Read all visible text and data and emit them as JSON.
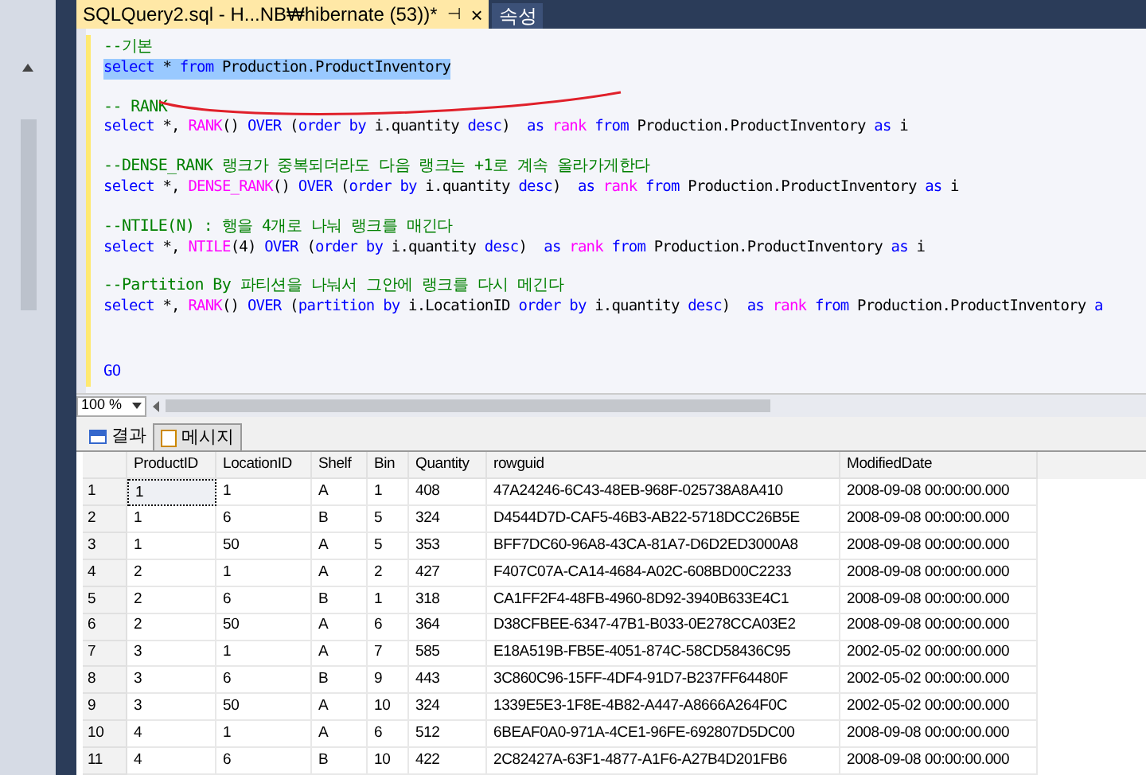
{
  "tabs": [
    {
      "label": "SQLQuery2.sql - H...NB₩hibernate (53))*",
      "selected": true,
      "pin": "⊣",
      "close": "×"
    },
    {
      "label": "속성",
      "selected": false
    }
  ],
  "editor": {
    "blocks": [
      [
        {
          "selected": false,
          "segments": [
            {
              "kind": "comment",
              "text": "--기본"
            }
          ]
        },
        {
          "selected": true,
          "segments": [
            {
              "kind": "keyword",
              "text": "select"
            },
            {
              "kind": "plain",
              "text": " * "
            },
            {
              "kind": "keyword",
              "text": "from"
            },
            {
              "kind": "plain",
              "text": " Production.ProductInventory"
            }
          ]
        }
      ],
      [
        {
          "selected": false,
          "segments": [
            {
              "kind": "comment",
              "text": "-- RANK"
            }
          ]
        },
        {
          "selected": false,
          "segments": [
            {
              "kind": "keyword",
              "text": "select"
            },
            {
              "kind": "plain",
              "text": " *, "
            },
            {
              "kind": "function",
              "text": "RANK"
            },
            {
              "kind": "plain",
              "text": "() "
            },
            {
              "kind": "keyword",
              "text": "OVER"
            },
            {
              "kind": "plain",
              "text": " ("
            },
            {
              "kind": "keyword",
              "text": "order by"
            },
            {
              "kind": "plain",
              "text": " i.quantity "
            },
            {
              "kind": "keyword",
              "text": "desc"
            },
            {
              "kind": "plain",
              "text": ")  "
            },
            {
              "kind": "keyword",
              "text": "as "
            },
            {
              "kind": "function",
              "text": "rank "
            },
            {
              "kind": "keyword",
              "text": "from"
            },
            {
              "kind": "plain",
              "text": " Production.ProductInventory "
            },
            {
              "kind": "keyword",
              "text": "as"
            },
            {
              "kind": "plain",
              "text": " i"
            }
          ]
        }
      ],
      [
        {
          "selected": false,
          "segments": [
            {
              "kind": "comment",
              "text": "--DENSE_RANK 랭크가 중복되더라도 다음 랭크는 +1로 계속 올라가게한다"
            }
          ]
        },
        {
          "selected": false,
          "segments": [
            {
              "kind": "keyword",
              "text": "select"
            },
            {
              "kind": "plain",
              "text": " *, "
            },
            {
              "kind": "function",
              "text": "DENSE_RANK"
            },
            {
              "kind": "plain",
              "text": "() "
            },
            {
              "kind": "keyword",
              "text": "OVER"
            },
            {
              "kind": "plain",
              "text": " ("
            },
            {
              "kind": "keyword",
              "text": "order by"
            },
            {
              "kind": "plain",
              "text": " i.quantity "
            },
            {
              "kind": "keyword",
              "text": "desc"
            },
            {
              "kind": "plain",
              "text": ")  "
            },
            {
              "kind": "keyword",
              "text": "as "
            },
            {
              "kind": "function",
              "text": "rank "
            },
            {
              "kind": "keyword",
              "text": "from"
            },
            {
              "kind": "plain",
              "text": " Production.ProductInventory "
            },
            {
              "kind": "keyword",
              "text": "as"
            },
            {
              "kind": "plain",
              "text": " i"
            }
          ]
        }
      ],
      [
        {
          "selected": false,
          "segments": [
            {
              "kind": "comment",
              "text": "--NTILE(N) : 행을 4개로 나눠 랭크를 매긴다"
            }
          ]
        },
        {
          "selected": false,
          "segments": [
            {
              "kind": "keyword",
              "text": "select"
            },
            {
              "kind": "plain",
              "text": " *, "
            },
            {
              "kind": "function",
              "text": "NTILE"
            },
            {
              "kind": "plain",
              "text": "(4) "
            },
            {
              "kind": "keyword",
              "text": "OVER"
            },
            {
              "kind": "plain",
              "text": " ("
            },
            {
              "kind": "keyword",
              "text": "order by"
            },
            {
              "kind": "plain",
              "text": " i.quantity "
            },
            {
              "kind": "keyword",
              "text": "desc"
            },
            {
              "kind": "plain",
              "text": ")  "
            },
            {
              "kind": "keyword",
              "text": "as "
            },
            {
              "kind": "function",
              "text": "rank "
            },
            {
              "kind": "keyword",
              "text": "from"
            },
            {
              "kind": "plain",
              "text": " Production.ProductInventory "
            },
            {
              "kind": "keyword",
              "text": "as"
            },
            {
              "kind": "plain",
              "text": " i"
            }
          ]
        }
      ],
      [
        {
          "selected": false,
          "segments": [
            {
              "kind": "comment",
              "text": "--Partition By 파티션을 나눠서 그안에 랭크를 다시 메긴다"
            }
          ]
        },
        {
          "selected": false,
          "segments": [
            {
              "kind": "keyword",
              "text": "select"
            },
            {
              "kind": "plain",
              "text": " *, "
            },
            {
              "kind": "function",
              "text": "RANK"
            },
            {
              "kind": "plain",
              "text": "() "
            },
            {
              "kind": "keyword",
              "text": "OVER"
            },
            {
              "kind": "plain",
              "text": " ("
            },
            {
              "kind": "keyword",
              "text": "partition by"
            },
            {
              "kind": "plain",
              "text": " i.LocationID "
            },
            {
              "kind": "keyword",
              "text": "order by"
            },
            {
              "kind": "plain",
              "text": " i.quantity "
            },
            {
              "kind": "keyword",
              "text": "desc"
            },
            {
              "kind": "plain",
              "text": ")  "
            },
            {
              "kind": "keyword",
              "text": "as "
            },
            {
              "kind": "function",
              "text": "rank "
            },
            {
              "kind": "keyword",
              "text": "from"
            },
            {
              "kind": "plain",
              "text": " Production.ProductInventory "
            },
            {
              "kind": "keyword",
              "text": "a"
            }
          ]
        }
      ],
      [
        {
          "selected": false,
          "segments": [
            {
              "kind": "keyword",
              "text": "GO"
            }
          ]
        }
      ]
    ]
  },
  "zoom": {
    "value": "100 %"
  },
  "result_tabs": [
    {
      "label": "결과",
      "selected": true
    },
    {
      "label": "메시지",
      "selected": false
    }
  ],
  "table": {
    "columns": [
      "ProductID",
      "LocationID",
      "Shelf",
      "Bin",
      "Quantity",
      "rowguid",
      "ModifiedDate"
    ],
    "rows": [
      {
        "number": "1",
        "focused": true,
        "cells": [
          "1",
          "1",
          "A",
          "1",
          "408",
          "47A24246-6C43-48EB-968F-025738A8A410",
          "2008-09-08 00:00:00.000"
        ]
      },
      {
        "number": "2",
        "focused": false,
        "cells": [
          "1",
          "6",
          "B",
          "5",
          "324",
          "D4544D7D-CAF5-46B3-AB22-5718DCC26B5E",
          "2008-09-08 00:00:00.000"
        ]
      },
      {
        "number": "3",
        "focused": false,
        "cells": [
          "1",
          "50",
          "A",
          "5",
          "353",
          "BFF7DC60-96A8-43CA-81A7-D6D2ED3000A8",
          "2008-09-08 00:00:00.000"
        ]
      },
      {
        "number": "4",
        "focused": false,
        "cells": [
          "2",
          "1",
          "A",
          "2",
          "427",
          "F407C07A-CA14-4684-A02C-608BD00C2233",
          "2008-09-08 00:00:00.000"
        ]
      },
      {
        "number": "5",
        "focused": false,
        "cells": [
          "2",
          "6",
          "B",
          "1",
          "318",
          "CA1FF2F4-48FB-4960-8D92-3940B633E4C1",
          "2008-09-08 00:00:00.000"
        ]
      },
      {
        "number": "6",
        "focused": false,
        "cells": [
          "2",
          "50",
          "A",
          "6",
          "364",
          "D38CFBEE-6347-47B1-B033-0E278CCA03E2",
          "2008-09-08 00:00:00.000"
        ]
      },
      {
        "number": "7",
        "focused": false,
        "cells": [
          "3",
          "1",
          "A",
          "7",
          "585",
          "E18A519B-FB5E-4051-874C-58CD58436C95",
          "2002-05-02 00:00:00.000"
        ]
      },
      {
        "number": "8",
        "focused": false,
        "cells": [
          "3",
          "6",
          "B",
          "9",
          "443",
          "3C860C96-15FF-4DF4-91D7-B237FF64480F",
          "2002-05-02 00:00:00.000"
        ]
      },
      {
        "number": "9",
        "focused": false,
        "cells": [
          "3",
          "50",
          "A",
          "10",
          "324",
          "1339E5E3-1F8E-4B82-A447-A8666A264F0C",
          "2002-05-02 00:00:00.000"
        ]
      },
      {
        "number": "10",
        "focused": false,
        "cells": [
          "4",
          "1",
          "A",
          "6",
          "512",
          "6BEAF0A0-971A-4CE1-96FE-692807D5DC00",
          "2008-09-08 00:00:00.000"
        ]
      },
      {
        "number": "11",
        "focused": false,
        "cells": [
          "4",
          "6",
          "B",
          "10",
          "422",
          "2C82427A-63F1-4877-A1F6-A27B4D201FB6",
          "2008-09-08 00:00:00.000"
        ]
      }
    ]
  }
}
